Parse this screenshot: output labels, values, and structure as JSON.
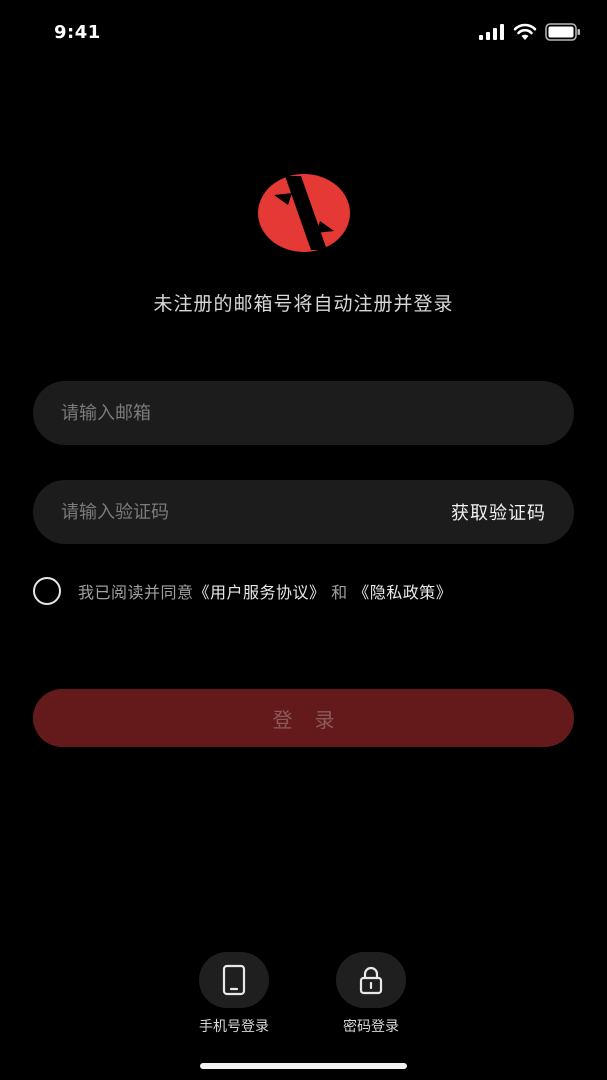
{
  "status_bar": {
    "time": "9:41"
  },
  "colors": {
    "background": "#000000",
    "brand_red": "#e53935",
    "login_button_disabled": "#641a1a",
    "field_background": "#1c1c1c"
  },
  "notice": "未注册的邮箱号将自动注册并登录",
  "email": {
    "placeholder": "请输入邮箱",
    "value": ""
  },
  "code": {
    "placeholder": "请输入验证码",
    "value": "",
    "get_code_label": "获取验证码"
  },
  "agreement": {
    "checked": false,
    "prefix": "我已阅读并同意",
    "terms_link": "《用户服务协议》",
    "conjunction": "和",
    "privacy_link": "《隐私政策》"
  },
  "login_button": {
    "label": "登录",
    "enabled": false
  },
  "alt_logins": [
    {
      "label": "手机号登录",
      "icon": "phone-icon"
    },
    {
      "label": "密码登录",
      "icon": "lock-icon"
    }
  ]
}
